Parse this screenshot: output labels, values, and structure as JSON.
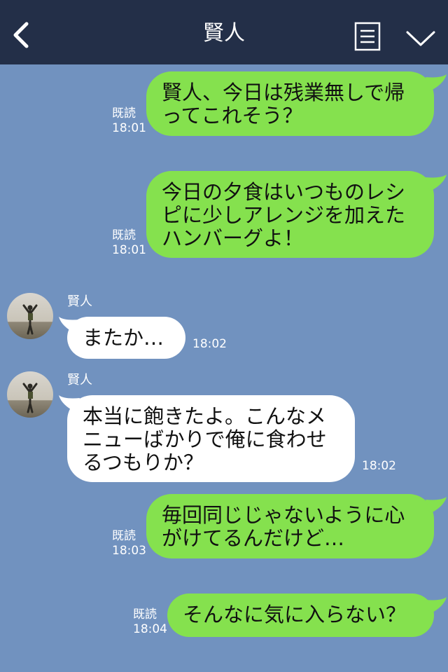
{
  "header": {
    "title": "賢人"
  },
  "messages": [
    {
      "direction": "out",
      "lines": [
        "賢人、今日は残業無しで帰",
        "ってこれそう？"
      ],
      "read_label": "既読",
      "time": "18:01"
    },
    {
      "direction": "out",
      "lines": [
        "今日の夕食はいつものレシ",
        "ピに少しアレンジを加えた",
        "ハンバーグよ！"
      ],
      "read_label": "既読",
      "time": "18:01"
    },
    {
      "direction": "in",
      "sender": "賢人",
      "lines": [
        "またか…"
      ],
      "time": "18:02"
    },
    {
      "direction": "in",
      "sender": "賢人",
      "lines": [
        "本当に飽きたよ。こんなメ",
        "ニューばかりで俺に食わせ",
        "るつもりか？"
      ],
      "time": "18:02"
    },
    {
      "direction": "out",
      "lines": [
        "毎回同じじゃないように心",
        "がけてるんだけど…"
      ],
      "read_label": "既読",
      "time": "18:03"
    },
    {
      "direction": "out",
      "lines": [
        "そんなに気に入らない？"
      ],
      "read_label": "既読",
      "time": "18:04"
    }
  ],
  "colors": {
    "background": "#7192bf",
    "header": "#232f48",
    "outgoing_bubble": "#85e14e",
    "incoming_bubble": "#ffffff"
  },
  "icons": {
    "back": "chevron-left-icon",
    "menu": "document-menu-icon",
    "collapse": "chevron-down-icon",
    "avatar": "avatar-icon"
  }
}
